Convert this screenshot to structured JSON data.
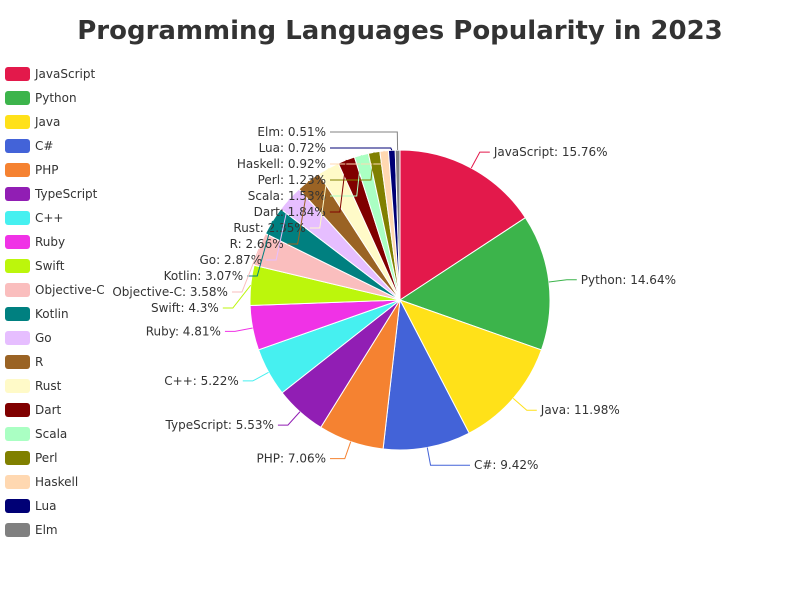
{
  "chart_data": {
    "type": "pie",
    "title": "Programming Languages Popularity in 2023",
    "legend_position": "left",
    "categories": [
      "JavaScript",
      "Python",
      "Java",
      "C#",
      "PHP",
      "TypeScript",
      "C++",
      "Ruby",
      "Swift",
      "Objective-C",
      "Kotlin",
      "Go",
      "R",
      "Rust",
      "Dart",
      "Scala",
      "Perl",
      "Haskell",
      "Lua",
      "Elm"
    ],
    "values": [
      15.76,
      14.64,
      11.98,
      9.42,
      7.06,
      5.53,
      5.22,
      4.81,
      4.3,
      3.58,
      3.07,
      2.87,
      2.66,
      2.35,
      1.84,
      1.53,
      1.23,
      0.92,
      0.72,
      0.51
    ],
    "data_labels": [
      "JavaScript: 15.76%",
      "Python: 14.64%",
      "Java: 11.98%",
      "C#: 9.42%",
      "PHP: 7.06%",
      "TypeScript: 5.53%",
      "C++: 5.22%",
      "Ruby: 4.81%",
      "Swift: 4.3%",
      "Objective-C: 3.58%",
      "Kotlin: 3.07%",
      "Go: 2.87%",
      "R: 2.66%",
      "Rust: 2.35%",
      "Dart: 1.84%",
      "Scala: 1.53%",
      "Perl: 1.23%",
      "Haskell: 0.92%",
      "Lua: 0.72%",
      "Elm: 0.51%"
    ],
    "colors": [
      "#e3194b",
      "#3cb44b",
      "#ffe119",
      "#4363d8",
      "#f58231",
      "#911eb4",
      "#46f0f0",
      "#f032e6",
      "#bcf60c",
      "#fabebe",
      "#008080",
      "#e6beff",
      "#9a6324",
      "#fffac8",
      "#800000",
      "#aaffc3",
      "#808000",
      "#ffd8b1",
      "#000075",
      "#808080"
    ]
  }
}
